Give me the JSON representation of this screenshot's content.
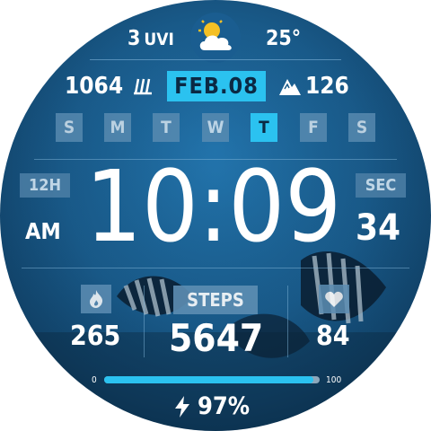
{
  "weather": {
    "uv_value": "3",
    "uv_unit": "UVI",
    "temperature": "25°",
    "icon": "partly-cloudy-icon"
  },
  "pressure": {
    "value": "1064",
    "icon": "pressure-icon"
  },
  "date": {
    "label": "FEB.08"
  },
  "elevation": {
    "value": "126",
    "icon": "mountain-icon"
  },
  "weekdays": {
    "items": [
      "S",
      "M",
      "T",
      "W",
      "T",
      "F",
      "S"
    ],
    "active_index": 4
  },
  "time": {
    "format_badge": "12H",
    "ampm": "AM",
    "display": "10:09",
    "seconds_badge": "SEC",
    "seconds": "34"
  },
  "calories": {
    "value": "265",
    "icon": "flame-icon"
  },
  "steps": {
    "label": "STEPS",
    "value": "5647"
  },
  "heart_rate": {
    "value": "84",
    "icon": "heart-icon"
  },
  "battery": {
    "min_label": "0",
    "max_label": "100",
    "level_percent": 97,
    "display": "97%",
    "icon": "bolt-icon"
  },
  "colors": {
    "accent": "#2bc2f0",
    "background": "#195b8b",
    "badge": "#5d8eb3",
    "text": "#ffffff"
  }
}
